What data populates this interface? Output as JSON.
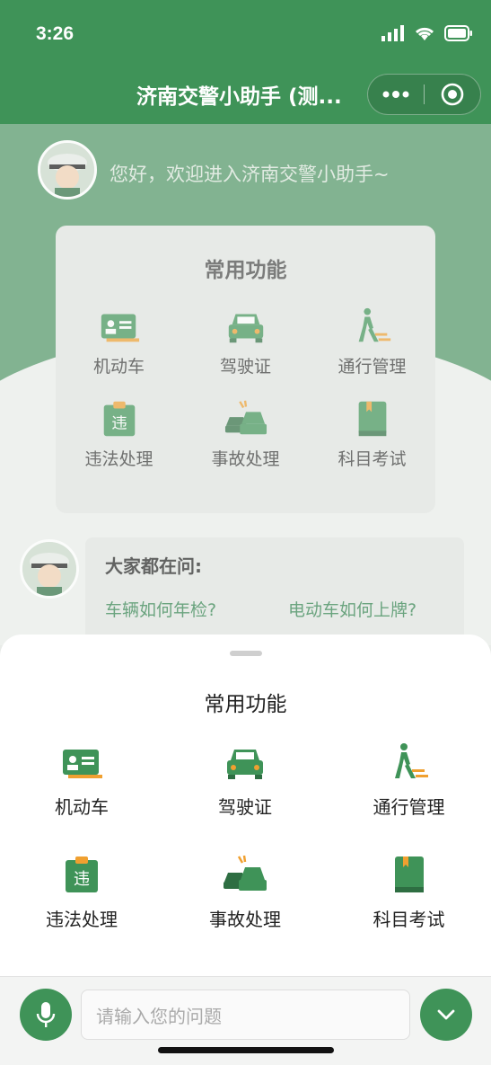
{
  "status": {
    "time": "3:26"
  },
  "header": {
    "title": "济南交警小助手 (测..."
  },
  "background": {
    "greeting": "您好，欢迎进入济南交警小助手~",
    "card_title": "常用功能",
    "items": [
      "机动车",
      "驾驶证",
      "通行管理",
      "违法处理",
      "事故处理",
      "科目考试"
    ],
    "ask": {
      "title": "大家都在问:",
      "q1": "车辆如何年检?",
      "q2": "电动车如何上牌?"
    }
  },
  "sheet": {
    "title": "常用功能",
    "items": [
      {
        "label": "机动车",
        "icon": "vehicle-license-icon"
      },
      {
        "label": "驾驶证",
        "icon": "car-front-icon"
      },
      {
        "label": "通行管理",
        "icon": "pedestrian-icon"
      },
      {
        "label": "违法处理",
        "icon": "violation-clipboard-icon"
      },
      {
        "label": "事故处理",
        "icon": "car-accident-icon"
      },
      {
        "label": "科目考试",
        "icon": "book-icon"
      }
    ]
  },
  "input": {
    "placeholder": "请输入您的问题"
  },
  "colors": {
    "brand": "#3f9358",
    "accent": "#f0a030"
  }
}
